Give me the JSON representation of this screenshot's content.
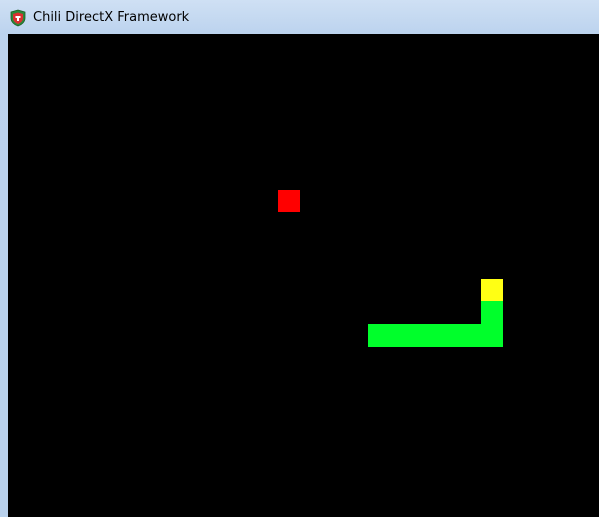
{
  "window": {
    "title": "Chili DirectX Framework",
    "icon": "chili-app-icon"
  },
  "game": {
    "background_color": "#000000",
    "snake_body_color": "#00ff2b",
    "snake_head_color": "#ffff14",
    "food_color": "#ff0000"
  }
}
